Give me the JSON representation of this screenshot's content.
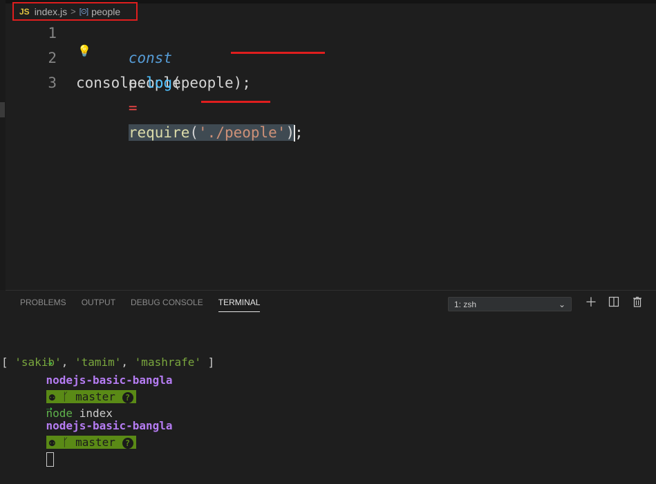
{
  "breadcrumb": {
    "file_icon": "JS",
    "file": "index.js",
    "separator": ">",
    "symbol_icon": "[⊙]",
    "symbol": "people"
  },
  "editor": {
    "line_numbers": [
      "1",
      "2",
      "3"
    ],
    "line1": {
      "keyword": "const",
      "name": "people",
      "op": "=",
      "func": "require",
      "paren_open": "(",
      "string": "'./people'",
      "paren_close": ")",
      "semi": ";"
    },
    "line3": {
      "obj": "console",
      "dot": ".",
      "method": "log",
      "args": "(people);"
    }
  },
  "panel": {
    "tabs": [
      "PROBLEMS",
      "OUTPUT",
      "DEBUG CONSOLE",
      "TERMINAL"
    ],
    "active_tab": "TERMINAL",
    "terminal_select": "1: zsh",
    "icons": [
      "plus-icon",
      "split-icon",
      "trash-icon"
    ]
  },
  "terminal": {
    "arrow": "➝",
    "dir": "nodejs-basic-bangla",
    "git_icon": "⚉",
    "branch_icon": "ᚴ",
    "branch": "master",
    "git_status": "?",
    "command_node": "node",
    "command_arg": "index",
    "output_open": "[ ",
    "out1": "'sakib'",
    "out2": "'tamim'",
    "out3": "'mashrafe'",
    "output_close": " ]",
    "comma": ", "
  },
  "colors": {
    "annotation_red": "#e01e1e",
    "git_badge": "#5a8a16",
    "dir_purple": "#b57cf2",
    "prompt_green": "#3fd14a"
  }
}
